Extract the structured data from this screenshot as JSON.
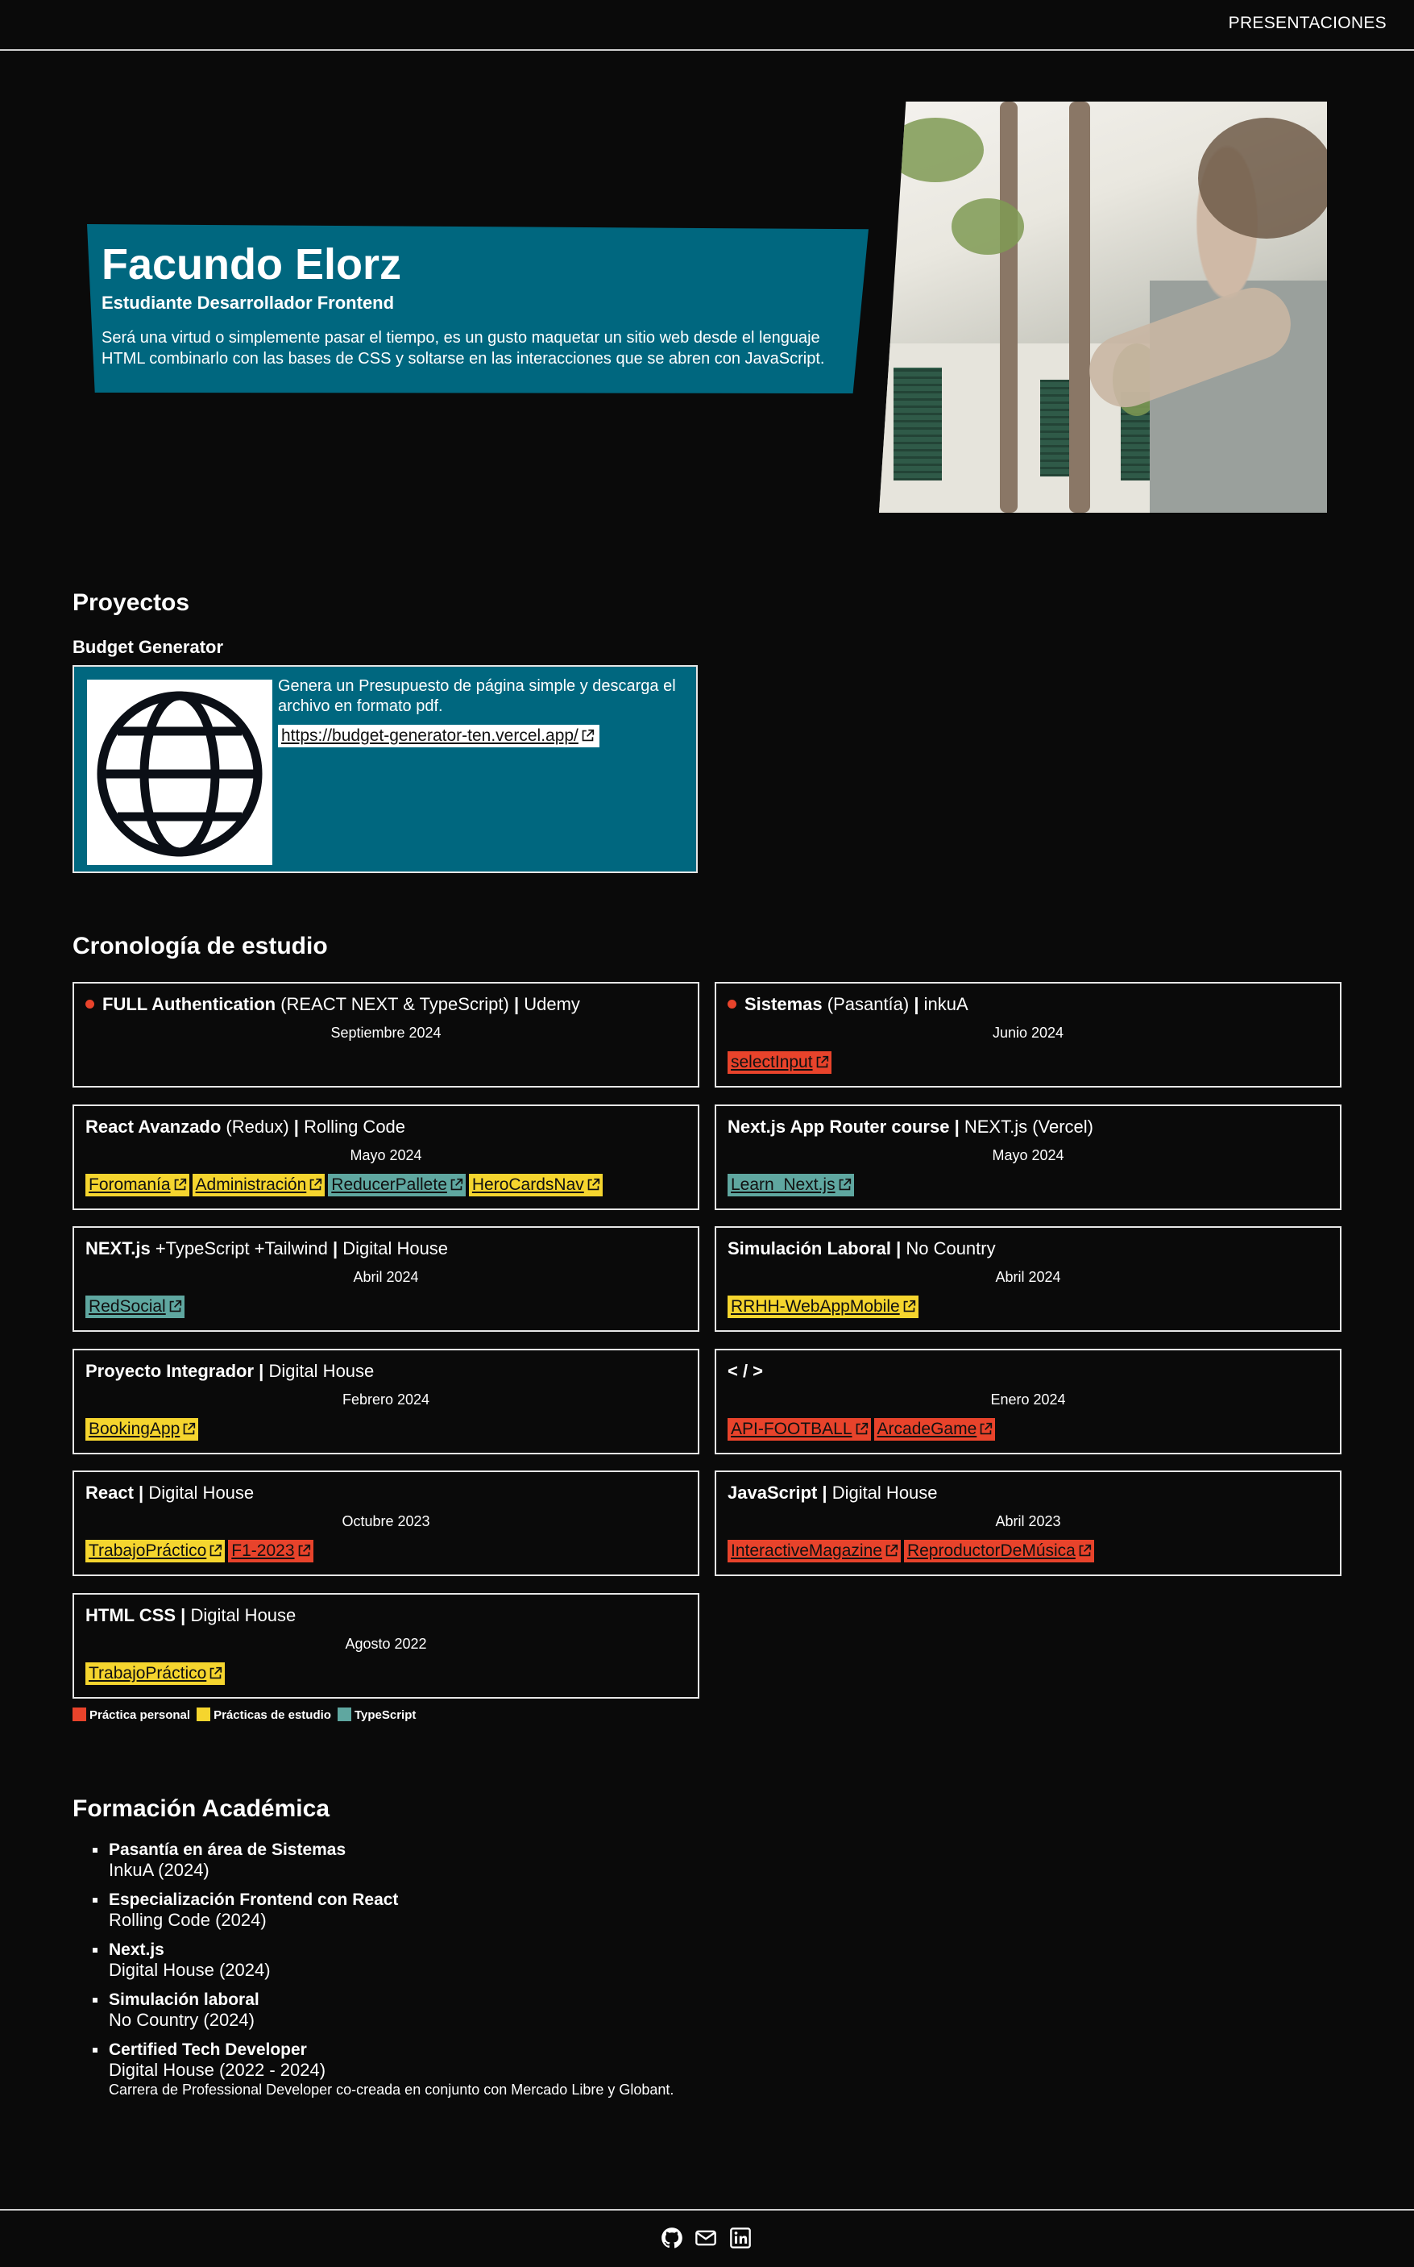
{
  "nav": {
    "link": "PRESENTACIONES"
  },
  "hero": {
    "name": "Facundo Elorz",
    "role": "Estudiante Desarrollador Frontend",
    "description": "Será una virtud o simplemente pasar el tiempo, es un gusto maquetar un sitio web desde el lenguaje HTML combinarlo con las bases de CSS y soltarse en las interacciones que se abren con JavaScript."
  },
  "projects": {
    "title": "Proyectos",
    "items": [
      {
        "name": "Budget Generator",
        "description": "Genera un Presupuesto de página simple y descarga el archivo en formato pdf.",
        "link": "https://budget-generator-ten.vercel.app/",
        "icon": "globe-icon"
      }
    ]
  },
  "timeline": {
    "title": "Cronología de estudio",
    "items": [
      {
        "strong": "FULL Authentication",
        "rest": " (REACT NEXT & TypeScript) ",
        "sep": "|",
        "org": " Udemy",
        "date": "Septiembre 2024",
        "current": true,
        "tags": []
      },
      {
        "strong": "Sistemas",
        "rest": " (Pasantía) ",
        "sep": "|",
        "org": " inkuA",
        "date": "Junio 2024",
        "current": true,
        "tags": [
          {
            "label": "selectInput",
            "type": "red"
          }
        ]
      },
      {
        "strong": "React Avanzado",
        "rest": " (Redux) ",
        "sep": "|",
        "org": " Rolling Code",
        "date": "Mayo 2024",
        "current": false,
        "tags": [
          {
            "label": "Foromanía",
            "type": "yellow"
          },
          {
            "label": "Administración",
            "type": "yellow"
          },
          {
            "label": "ReducerPallete",
            "type": "teal"
          },
          {
            "label": "HeroCardsNav",
            "type": "yellow"
          }
        ]
      },
      {
        "strong": "Next.js App Router course",
        "rest": " ",
        "sep": "|",
        "org": " NEXT.js (Vercel)",
        "date": "Mayo 2024",
        "current": false,
        "tags": [
          {
            "label": "Learn_Next.js",
            "type": "teal"
          }
        ]
      },
      {
        "strong": "NEXT.js",
        "rest": " +TypeScript +Tailwind ",
        "sep": "|",
        "org": " Digital House",
        "date": "Abril 2024",
        "current": false,
        "tags": [
          {
            "label": "RedSocial",
            "type": "teal"
          }
        ]
      },
      {
        "strong": "Simulación Laboral",
        "rest": " ",
        "sep": "|",
        "org": " No Country",
        "date": "Abril 2024",
        "current": false,
        "tags": [
          {
            "label": "RRHH-WebAppMobile",
            "type": "yellow"
          }
        ]
      },
      {
        "strong": "Proyecto Integrador",
        "rest": " ",
        "sep": "|",
        "org": " Digital House",
        "date": "Febrero 2024",
        "current": false,
        "tags": [
          {
            "label": "BookingApp",
            "type": "yellow"
          }
        ]
      },
      {
        "strong": "< / >",
        "rest": "",
        "sep": "",
        "org": "",
        "date": "Enero 2024",
        "current": false,
        "tags": [
          {
            "label": "API-FOOTBALL",
            "type": "red"
          },
          {
            "label": "ArcadeGame",
            "type": "red"
          }
        ]
      },
      {
        "strong": "React",
        "rest": " ",
        "sep": "|",
        "org": " Digital House",
        "date": "Octubre 2023",
        "current": false,
        "tags": [
          {
            "label": "TrabajoPráctico",
            "type": "yellow"
          },
          {
            "label": "F1-2023",
            "type": "red"
          }
        ]
      },
      {
        "strong": "JavaScript",
        "rest": " ",
        "sep": "|",
        "org": " Digital House",
        "date": "Abril 2023",
        "current": false,
        "tags": [
          {
            "label": "InteractiveMagazine",
            "type": "red"
          },
          {
            "label": "ReproductorDeMúsica",
            "type": "red"
          }
        ]
      },
      {
        "strong": "HTML CSS",
        "rest": " ",
        "sep": "|",
        "org": " Digital House",
        "date": "Agosto 2022",
        "current": false,
        "tags": [
          {
            "label": "TrabajoPráctico",
            "type": "yellow"
          }
        ]
      }
    ],
    "legend": [
      {
        "label": "Práctica personal",
        "color": "#e8432b"
      },
      {
        "label": "Prácticas de estudio",
        "color": "#f5d52e"
      },
      {
        "label": "TypeScript",
        "color": "#5fa7a0"
      }
    ]
  },
  "education": {
    "title": "Formación Académica",
    "items": [
      {
        "title": "Pasantía en área de Sistemas",
        "sub": "InkuA (2024)",
        "note": ""
      },
      {
        "title": "Especialización Frontend con React",
        "sub": "Rolling Code (2024)",
        "note": ""
      },
      {
        "title": "Next.js",
        "sub": "Digital House (2024)",
        "note": ""
      },
      {
        "title": "Simulación laboral",
        "sub": "No Country (2024)",
        "note": ""
      },
      {
        "title": "Certified Tech Developer",
        "sub": "Digital House (2022 - 2024)",
        "note": "Carrera de Professional Developer co-creada en conjunto con Mercado Libre y Globant."
      }
    ]
  },
  "footer": {
    "icons": [
      "github-icon",
      "mail-icon",
      "linkedin-icon"
    ]
  },
  "colors": {
    "accent": "#00677f",
    "red": "#e8432b",
    "yellow": "#f5d52e",
    "teal": "#5fa7a0",
    "background": "#0a0a0a"
  }
}
